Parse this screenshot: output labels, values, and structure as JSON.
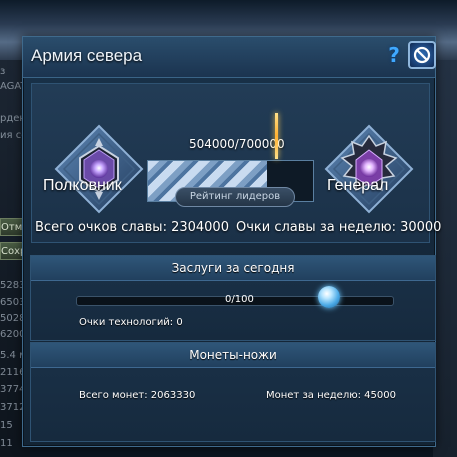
{
  "window": {
    "title": "Армия севера",
    "help_icon": "?"
  },
  "backdrop": {
    "text_lines": [
      "з",
      "AGATA",
      "рден Солн",
      "ия север",
      "5283/5283",
      "6503",
      "5028",
      "6200",
      "5.4 млрд",
      "2116",
      "3774",
      "37121",
      "15",
      "11"
    ],
    "buttons": [
      "Отм",
      "Сохран"
    ]
  },
  "rank": {
    "current_rank": "Полковник",
    "next_rank": "Генерал",
    "progress_text": "504000/700000",
    "progress_current": 504000,
    "progress_max": 700000,
    "leaderboard_button": "Рейтинг лидеров",
    "total_glory": "Всего очков славы: 2304000",
    "weekly_glory": "Очки славы за неделю: 30000"
  },
  "merits": {
    "header": "Заслуги за сегодня",
    "slider_text": "0/100",
    "slider_current": 0,
    "slider_max": 100,
    "tech_points": "Очки технологий: 0"
  },
  "coins": {
    "header": "Монеты-ножи",
    "total_coins": "Всего монет: 2063330",
    "weekly_coins": "Монет за неделю: 45000"
  },
  "colors": {
    "accent": "#3fa8ff",
    "window_bg": "#19324a",
    "marker": "#ffb030"
  }
}
